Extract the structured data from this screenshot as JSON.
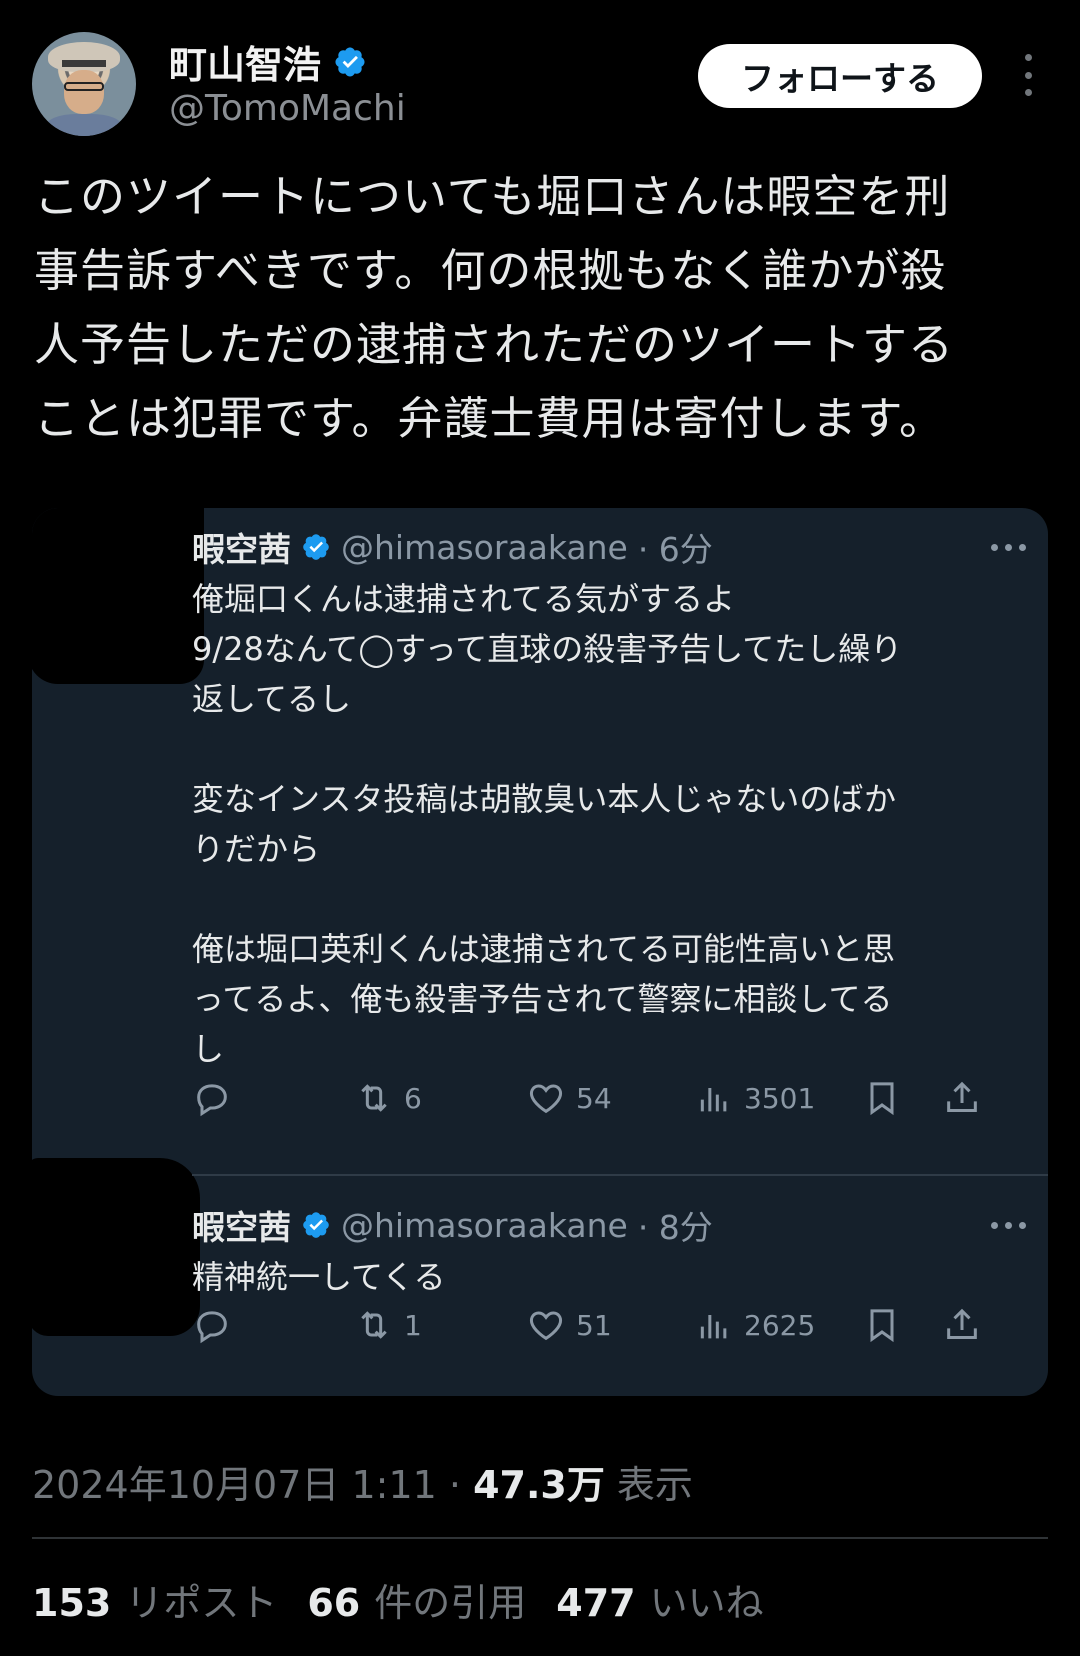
{
  "author": {
    "name": "町山智浩",
    "handle": "@TomoMachi",
    "follow_label": "フォローする"
  },
  "tweet": {
    "lines": [
      "このツイートについても堀口さんは暇空を刑",
      "事告訴すべきです。何の根拠もなく誰かが殺",
      "人予告しただの逮捕されただのツイートする",
      "ことは犯罪です。弁護士費用は寄付します。"
    ]
  },
  "quoted": [
    {
      "name": "暇空茜",
      "handle": "@himasoraakane",
      "time": "· 6分",
      "paragraphs": [
        [
          "俺堀口くんは逮捕されてる気がするよ",
          "9/28なんて◯すって直球の殺害予告してたし繰り",
          "返してるし"
        ],
        [
          "変なインスタ投稿は胡散臭い本人じゃないのばか",
          "りだから"
        ],
        [
          "俺は堀口英利くんは逮捕されてる可能性高いと思",
          "ってるよ、俺も殺害予告されて警察に相談してる",
          "し"
        ]
      ],
      "retweets": "6",
      "likes": "54",
      "views": "3501"
    },
    {
      "name": "暇空茜",
      "handle": "@himasoraakane",
      "time": "· 8分",
      "paragraphs": [
        [
          "精神統一してくる"
        ]
      ],
      "retweets": "1",
      "likes": "51",
      "views": "2625"
    }
  ],
  "meta": {
    "datetime": "2024年10月07日 1:11",
    "sep": " · ",
    "views_count": "47.3万",
    "views_label": " 表示"
  },
  "stats": {
    "reposts_count": "153",
    "reposts_label": "リポスト",
    "quotes_count": "66",
    "quotes_label": "件の引用",
    "likes_count": "477",
    "likes_label": "いいね"
  },
  "colors": {
    "background": "#000000",
    "quote_bg": "#15202b",
    "verified": "#1d9bf0",
    "muted": "#71767b"
  },
  "icons": [
    "verified-badge-icon",
    "more-vertical-icon",
    "more-horizontal-icon",
    "reply-icon",
    "retweet-icon",
    "like-icon",
    "views-icon",
    "bookmark-icon",
    "share-icon"
  ]
}
